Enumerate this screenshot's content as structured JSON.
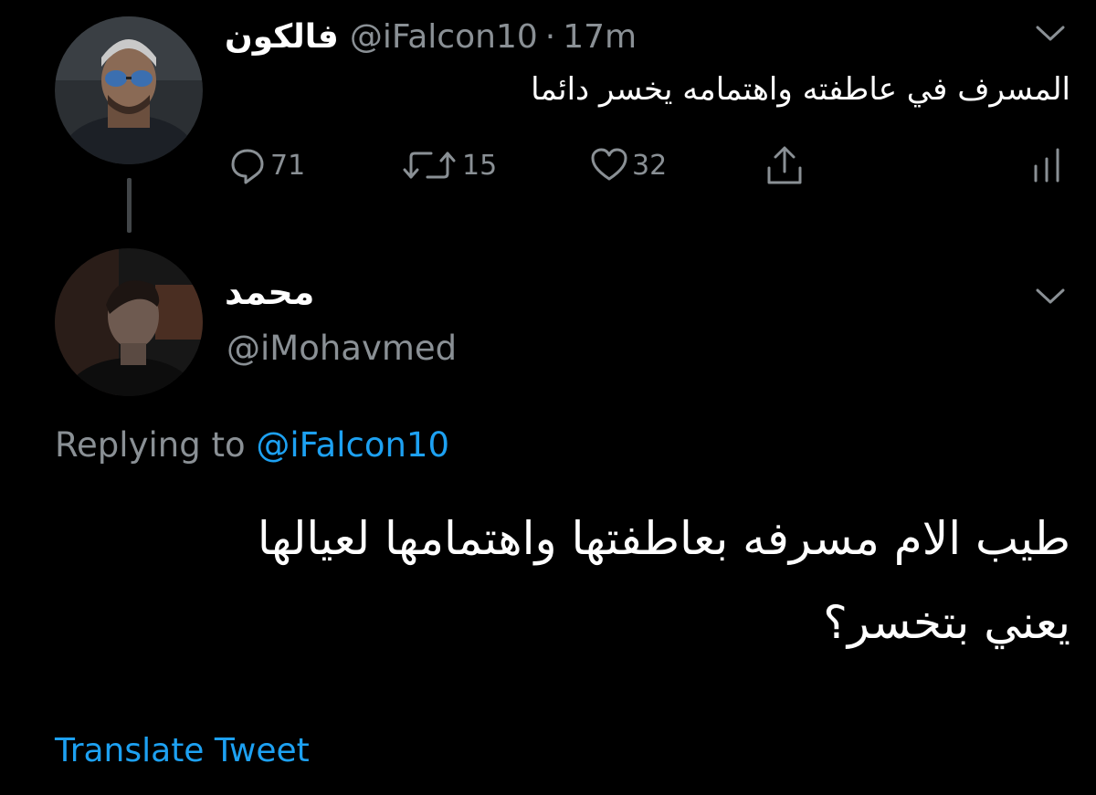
{
  "colors": {
    "background": "#000000",
    "primary_text": "#ffffff",
    "secondary_text": "#8a9095",
    "link": "#1da1f2",
    "thread_line": "#424649"
  },
  "tweet1": {
    "author_name": "فالكون",
    "handle": "@iFalcon10",
    "separator": "·",
    "time": "17m",
    "text": "المسرف في عاطفته واهتمامه يخسر دائما",
    "avatar_icon": "user-avatar",
    "actions": {
      "reply_icon": "reply-icon",
      "reply_count": "71",
      "retweet_icon": "retweet-icon",
      "retweet_count": "15",
      "like_icon": "heart-icon",
      "like_count": "32",
      "share_icon": "share-icon",
      "analytics_icon": "analytics-icon"
    }
  },
  "tweet2": {
    "author_name": "محمد",
    "handle": "@iMohavmed",
    "avatar_icon": "user-avatar",
    "replying_prefix": "Replying to ",
    "replying_to": "@iFalcon10",
    "text_line1": "طيب الام مسرفه بعاطفتها واهتمامها لعيالها",
    "text_line2": "يعني بتخسر؟",
    "translate_label": "Translate Tweet"
  }
}
